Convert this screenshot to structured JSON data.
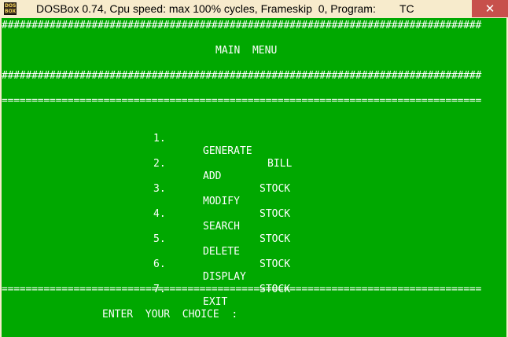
{
  "window": {
    "title": "DOSBox 0.74, Cpu speed: max 100% cycles, Frameskip  0, Program:",
    "program": "TC",
    "icon_label_top": "DOS",
    "icon_label_bottom": "BOX",
    "close_glyph": "✕",
    "icon_name": "dosbox-icon"
  },
  "screen": {
    "hash_rule": "################################################################################",
    "equals_rule": "================================================================================",
    "menu_title": "MAIN  MENU",
    "items": [
      {
        "number": "1.",
        "word1": "GENERATE",
        "word2": "BILL",
        "word2_offset": "generate"
      },
      {
        "number": "2.",
        "word1": "ADD",
        "word2": "STOCK"
      },
      {
        "number": "3.",
        "word1": "MODIFY",
        "word2": "STOCK"
      },
      {
        "number": "4.",
        "word1": "SEARCH",
        "word2": "STOCK"
      },
      {
        "number": "5.",
        "word1": "DELETE",
        "word2": "STOCK"
      },
      {
        "number": "6.",
        "word1": "DISPLAY",
        "word2": "STOCK"
      },
      {
        "number": "7.",
        "word1": "EXIT",
        "word2": ""
      }
    ],
    "prompt": "ENTER  YOUR  CHOICE  :",
    "background_color": "#00a800",
    "text_color": "#ffffff"
  }
}
